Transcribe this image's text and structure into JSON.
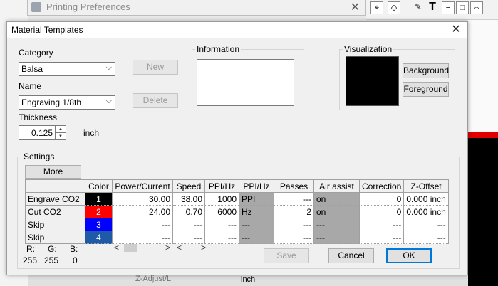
{
  "background_window": {
    "title": "Printing Preferences",
    "toolbar_units": "in",
    "bottom_label": "Z-Adjust/L",
    "bottom_unit": "inch"
  },
  "dialog": {
    "title": "Material Templates",
    "category_label": "Category",
    "category_value": "Balsa",
    "name_label": "Name",
    "name_value": "Engraving 1/8th",
    "thickness_label": "Thickness",
    "thickness_value": "0.125",
    "thickness_unit": "inch",
    "new_label": "New",
    "delete_label": "Delete",
    "information_label": "Information",
    "visualization_label": "Visualization",
    "background_label": "Background",
    "foreground_label": "Foreground",
    "settings_label": "Settings",
    "more_label": "More",
    "save_label": "Save",
    "cancel_label": "Cancel",
    "ok_label": "OK",
    "rgb": {
      "r_label": "R:",
      "g_label": "G:",
      "b_label": "B:",
      "r": "255",
      "g": "255",
      "b": "0"
    }
  },
  "table": {
    "headers": [
      "Color",
      "Power/Current",
      "Speed",
      "PPI/Hz",
      "PPI/Hz",
      "Passes",
      "Air assist",
      "Correction",
      "Z-Offset"
    ],
    "rows": [
      {
        "name": "Engrave CO2",
        "color_num": "1",
        "color": "#000000",
        "power": "30.00",
        "speed": "38.00",
        "ppi": "1000",
        "mode": "PPI",
        "passes": "---",
        "air": "on",
        "correction": "0",
        "zoffset": "0.000 inch"
      },
      {
        "name": "Cut CO2",
        "color_num": "2",
        "color": "#ff0000",
        "power": "24.00",
        "speed": "0.70",
        "ppi": "6000",
        "mode": "Hz",
        "passes": "2",
        "air": "on",
        "correction": "0",
        "zoffset": "0.000 inch"
      },
      {
        "name": "Skip",
        "color_num": "3",
        "color": "#0000ff",
        "power": "---",
        "speed": "---",
        "ppi": "---",
        "mode": "---",
        "passes": "---",
        "air": "---",
        "correction": "---",
        "zoffset": "---"
      },
      {
        "name": "Skip",
        "color_num": "4",
        "color": "#1f5aa6",
        "power": "---",
        "speed": "---",
        "ppi": "---",
        "mode": "---",
        "passes": "---",
        "air": "---",
        "correction": "---",
        "zoffset": "---"
      }
    ]
  }
}
